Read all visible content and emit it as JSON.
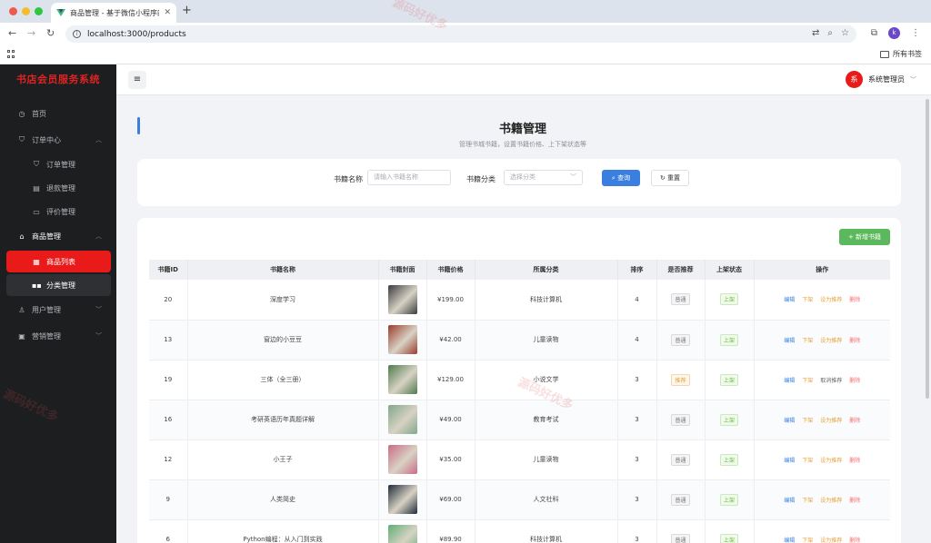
{
  "browser": {
    "tab_title": "商品管理 - 基于微信小程序的书",
    "url": "localhost:3000/products",
    "bookmarks_label": "所有书签",
    "profile_initial": "k"
  },
  "sidebar": {
    "brand": "书店会员服务系统",
    "items": [
      {
        "label": "首页",
        "icon": "dashboard-icon"
      },
      {
        "label": "订单中心",
        "icon": "cart-icon"
      },
      {
        "label": "订单管理",
        "icon": "cart-icon"
      },
      {
        "label": "退款管理",
        "icon": "refund-icon"
      },
      {
        "label": "评价管理",
        "icon": "comment-icon"
      },
      {
        "label": "商品管理",
        "icon": "shop-icon"
      },
      {
        "label": "商品列表",
        "icon": "list-icon"
      },
      {
        "label": "分类管理",
        "icon": "grid-icon"
      },
      {
        "label": "用户管理",
        "icon": "user-icon"
      },
      {
        "label": "营销管理",
        "icon": "marketing-icon"
      }
    ]
  },
  "header": {
    "avatar_text": "系",
    "username": "系统管理员"
  },
  "page": {
    "title": "书籍管理",
    "subtitle": "管理书城书籍，设置书籍价格、上下架状态等"
  },
  "search": {
    "name_label": "书籍名称",
    "name_placeholder": "请输入书籍名称",
    "category_label": "书籍分类",
    "category_placeholder": "选择分类",
    "query_label": "查询",
    "reset_label": "重置"
  },
  "table": {
    "add_label": "+ 新增书籍",
    "columns": [
      "书籍ID",
      "书籍名称",
      "书籍封面",
      "书籍价格",
      "所属分类",
      "排序",
      "是否推荐",
      "上架状态",
      "操作"
    ],
    "rows": [
      {
        "id": "20",
        "name": "深度学习",
        "price": "¥199.00",
        "category": "科技计算机",
        "sort": "4",
        "recommend": "普通",
        "status": "上架",
        "rec_action": "设为推荐",
        "cover_color": "#3a3a40"
      },
      {
        "id": "13",
        "name": "窗边的小豆豆",
        "price": "¥42.00",
        "category": "儿童读物",
        "sort": "4",
        "recommend": "普通",
        "status": "上架",
        "rec_action": "设为推荐",
        "cover_color": "#9a3b2c"
      },
      {
        "id": "19",
        "name": "三体（全三册）",
        "price": "¥129.00",
        "category": "小说文学",
        "sort": "3",
        "recommend": "推荐",
        "status": "上架",
        "rec_action": "取消推荐",
        "cover_color": "#4f7a4c"
      },
      {
        "id": "16",
        "name": "考研英语历年真题详解",
        "price": "¥49.00",
        "category": "教育考试",
        "sort": "3",
        "recommend": "普通",
        "status": "上架",
        "rec_action": "设为推荐",
        "cover_color": "#7fa88a"
      },
      {
        "id": "12",
        "name": "小王子",
        "price": "¥35.00",
        "category": "儿童读物",
        "sort": "3",
        "recommend": "普通",
        "status": "上架",
        "rec_action": "设为推荐",
        "cover_color": "#c96b86"
      },
      {
        "id": "9",
        "name": "人类简史",
        "price": "¥69.00",
        "category": "人文社科",
        "sort": "3",
        "recommend": "普通",
        "status": "上架",
        "rec_action": "设为推荐",
        "cover_color": "#1f2a3a"
      },
      {
        "id": "6",
        "name": "Python编程：从入门到实践",
        "price": "¥89.90",
        "category": "科技计算机",
        "sort": "3",
        "recommend": "普通",
        "status": "上架",
        "rec_action": "设为推荐",
        "cover_color": "#5fae77"
      }
    ],
    "ops": {
      "edit": "编辑",
      "down": "下架",
      "delete": "删除"
    }
  },
  "watermark": "源码好优多"
}
